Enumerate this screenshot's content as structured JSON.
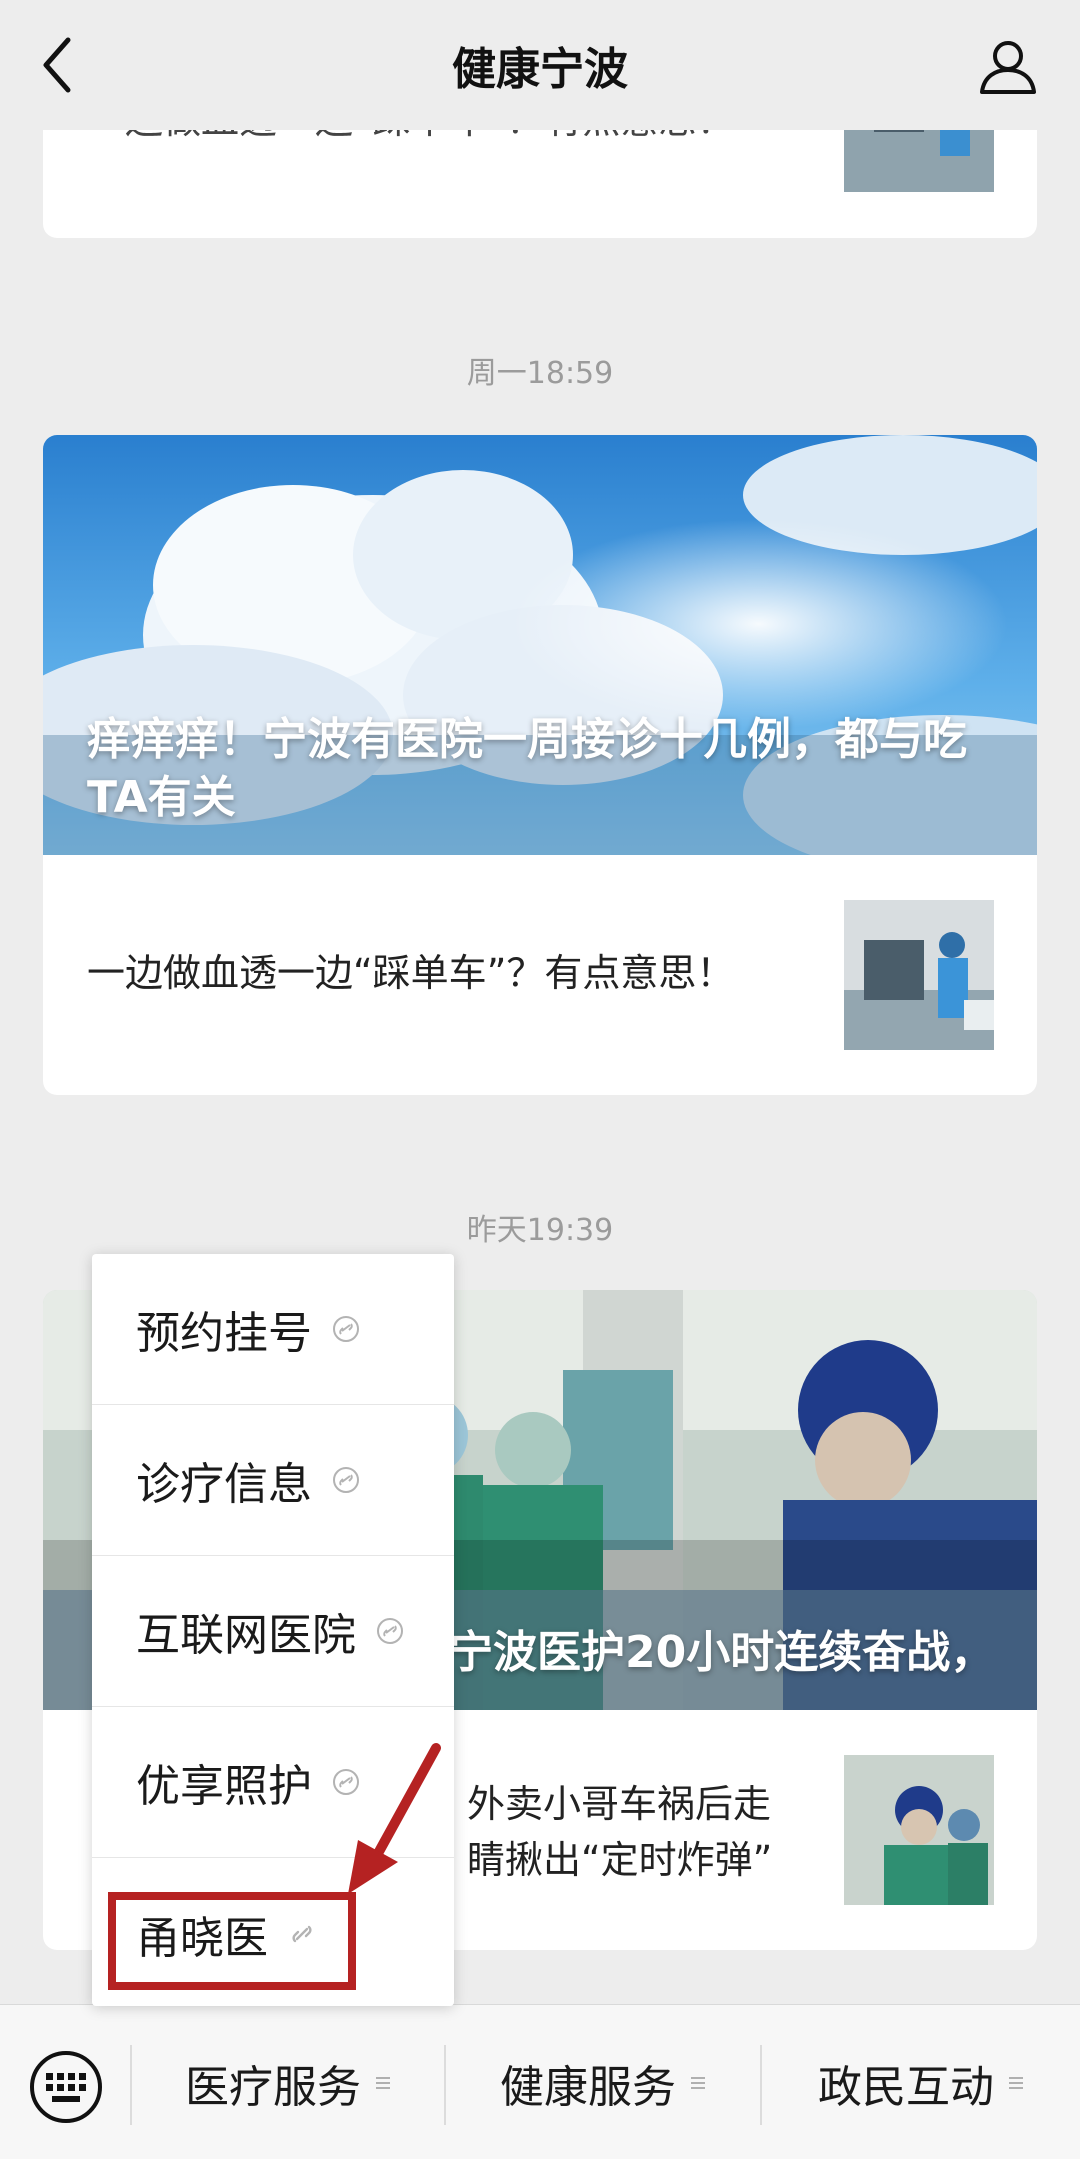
{
  "header": {
    "title": "健康宁波",
    "back_icon": "back-chevron-icon",
    "profile_icon": "person-icon"
  },
  "feed": {
    "top_partial": {
      "text": "一边做血透一边“踩单车”？有点意思！"
    },
    "groups": [
      {
        "time": "周一18:59",
        "hero_title": "痒痒痒！宁波有医院一周接诊十几例，都与吃TA有关",
        "item_text": "一边做血透一边“踩单车”？有点意思！"
      },
      {
        "time": "昨天19:39",
        "hero_title": "宁波医护20小时连续奋战，",
        "item_text_line1": "外卖小哥车祸后走",
        "item_text_line2": "睛揪出“定时炸弹”"
      }
    ]
  },
  "popup_menu": {
    "items": [
      {
        "label": "预约挂号"
      },
      {
        "label": "诊疗信息"
      },
      {
        "label": "互联网医院"
      },
      {
        "label": "优享照护"
      },
      {
        "label": "甬晓医"
      }
    ],
    "highlighted_item": "甬晓医",
    "annotation_color": "#b52222"
  },
  "bottom_menu": {
    "tabs": [
      {
        "label": "医疗服务"
      },
      {
        "label": "健康服务"
      },
      {
        "label": "政民互动"
      }
    ],
    "keyboard_icon": "keyboard-icon"
  }
}
